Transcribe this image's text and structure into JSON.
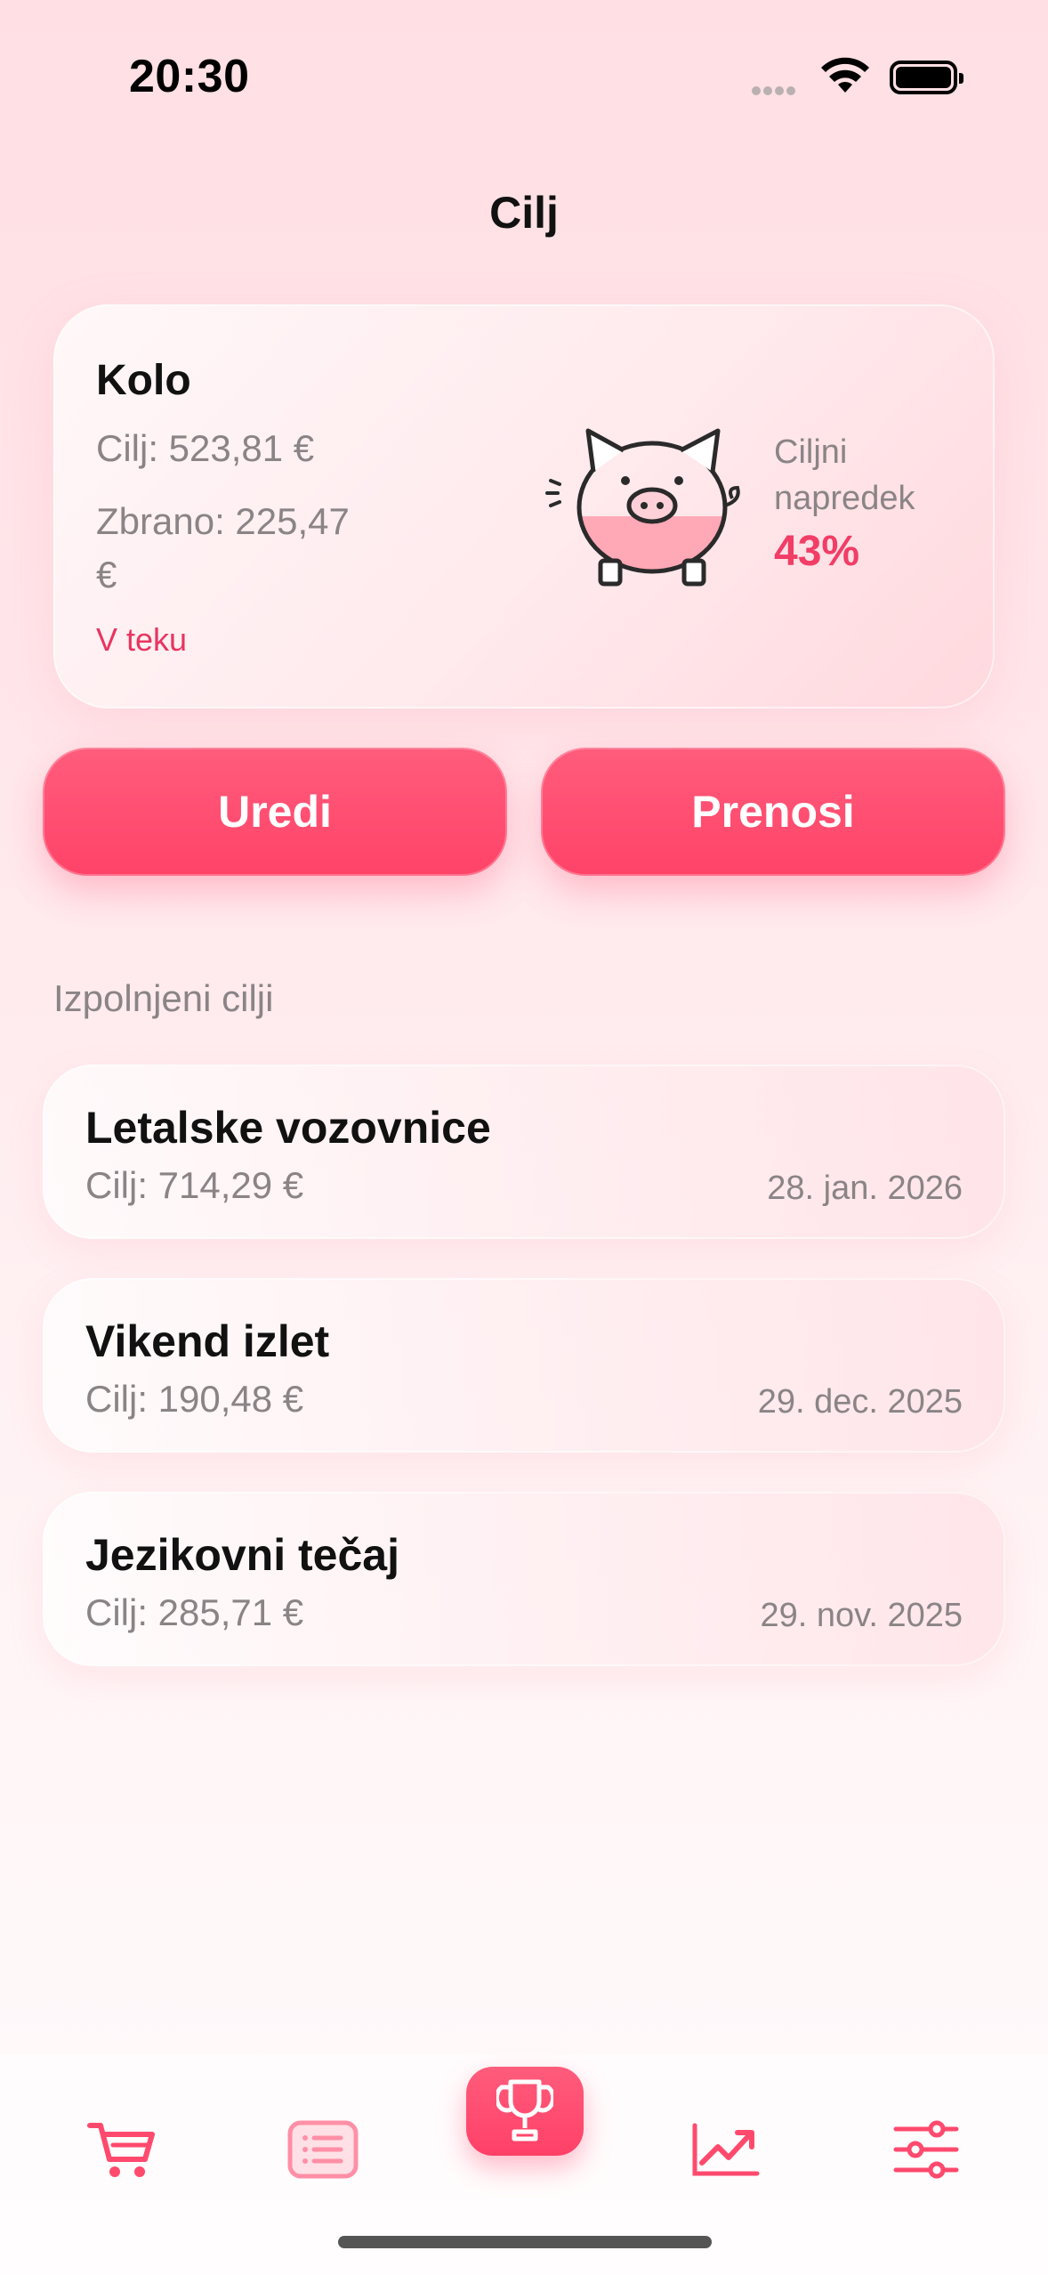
{
  "status_bar": {
    "time": "20:30"
  },
  "header": {
    "title": "Cilj"
  },
  "current_goal": {
    "name": "Kolo",
    "target": "Cilj: 523,81 €",
    "collected": "Zbrano: 225,47 €",
    "status": "V teku",
    "progress_label": "Ciljni napredek",
    "progress_value": "43%",
    "progress_fraction": 0.43
  },
  "actions": {
    "edit_label": "Uredi",
    "transfers_label": "Prenosi"
  },
  "completed": {
    "title": "Izpolnjeni cilji",
    "items": [
      {
        "name": "Letalske vozovnice",
        "target": "Cilj: 714,29 €",
        "date": "28. jan. 2026"
      },
      {
        "name": "Vikend izlet",
        "target": "Cilj: 190,48 €",
        "date": "29. dec. 2025"
      },
      {
        "name": "Jezikovni tečaj",
        "target": "Cilj: 285,71 €",
        "date": "29. nov. 2025"
      }
    ]
  },
  "tab_bar": {
    "tabs": [
      {
        "icon": "cart-icon"
      },
      {
        "icon": "list-icon"
      },
      {
        "icon": "trophy-icon",
        "active": true
      },
      {
        "icon": "chart-icon"
      },
      {
        "icon": "sliders-icon"
      }
    ]
  },
  "colors": {
    "accent": "#ff4a6e",
    "muted_text": "#8a8486",
    "status": "#e83560"
  }
}
